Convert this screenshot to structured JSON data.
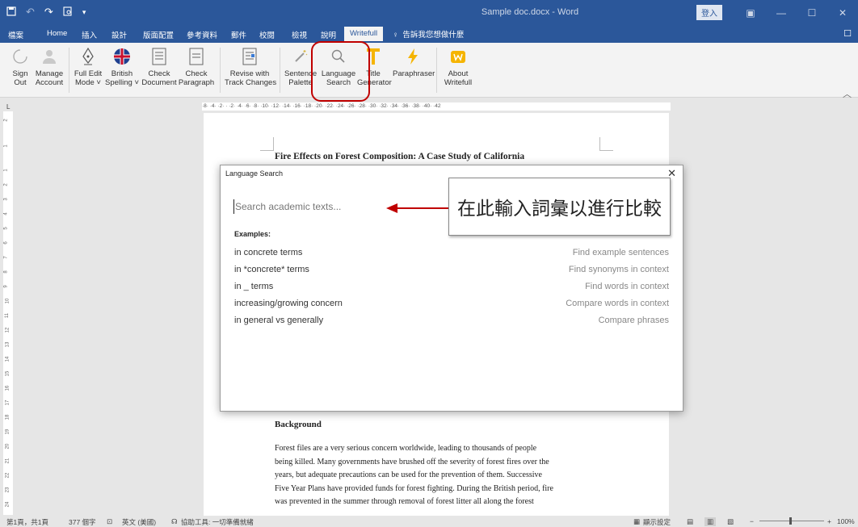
{
  "app": {
    "doc_title": "Sample doc.docx - Word",
    "login_label": "登入"
  },
  "quick_access": [
    "save-icon",
    "undo-icon",
    "redo-icon",
    "print-preview-icon"
  ],
  "tabs": [
    "檔案",
    "Home",
    "插入",
    "設計",
    "版面配置",
    "參考資料",
    "郵件",
    "校閱",
    "檢視",
    "說明",
    "Writefull"
  ],
  "active_tab": "Writefull",
  "tell_me": "告訴我您想做什麼",
  "ribbon": {
    "sign_out": "Sign\nOut",
    "manage_account": "Manage\nAccount",
    "full_edit_mode": "Full Edit\nMode ˅",
    "british_spelling": "British\nSpelling ˅",
    "check_document": "Check\nDocument",
    "check_paragraph": "Check\nParagraph",
    "revise_track_changes": "Revise with\nTrack Changes",
    "sentence_palette": "Sentence\nPalette",
    "language_search": "Language\nSearch",
    "title_generator": "Title\nGenerator",
    "paraphraser": "Paraphraser",
    "about_writefull": "About\nWritefull"
  },
  "ruler": {
    "horizontal": "·8· ·4· ·2· ·  ·2· ·4· ·6· ·8· ·10· ·12· ·14· ·16· ·18· ·20· ·22· ·24· ·26· ·28· ·30· ·32· ·34· ·36· ·38· ·40· ·42",
    "vertical": [
      "2",
      "1",
      "1",
      "2",
      "3",
      "4",
      "5",
      "6",
      "7",
      "8",
      "9",
      "10",
      "11",
      "12",
      "13",
      "14",
      "15",
      "16",
      "17",
      "18",
      "19",
      "20",
      "21",
      "22",
      "23",
      "24",
      "25",
      "26"
    ],
    "corner": "L"
  },
  "document": {
    "title": "Fire Effects on Forest Composition: A Case Study of California",
    "heading": "Background",
    "paragraph": [
      "Forest files are a very serious concern worldwide, leading to thousands of people",
      "being killed. Many governments have brushed off the severity of forest fires over the",
      "years, but adequate precautions can be used for the prevention of them. Successive",
      "Five Year Plans have provided funds for forest fighting. During the British period, fire",
      "was prevented in the summer through removal of forest litter all along the forest"
    ]
  },
  "dialog": {
    "title": "Language Search",
    "search_placeholder": "Search academic texts...",
    "examples_heading": "Examples:",
    "examples": [
      {
        "query": "in concrete terms",
        "description": "Find example sentences"
      },
      {
        "query": "in *concrete* terms",
        "description": "Find synonyms in context"
      },
      {
        "query": "in _ terms",
        "description": "Find words in context"
      },
      {
        "query": "increasing/growing concern",
        "description": "Compare words in context"
      },
      {
        "query": "in general vs generally",
        "description": "Compare phrases"
      }
    ]
  },
  "annotation": {
    "callout_text": "在此輸入詞彙以進行比較"
  },
  "status_bar": {
    "page": "第1頁，共1頁",
    "words": "377 個字",
    "language": "英文 (美國)",
    "accessibility": "協助工具: 一切準備就緒",
    "display_settings": "顯示設定",
    "zoom": "100%"
  },
  "colors": {
    "title_bar": "#2b579a",
    "highlight": "#c00000",
    "arrow": "#c00000"
  }
}
